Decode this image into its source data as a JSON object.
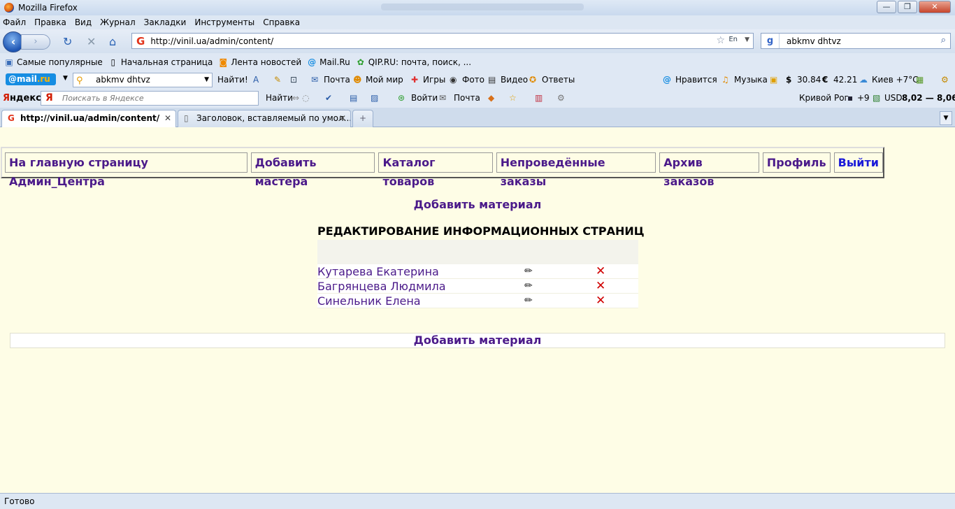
{
  "window": {
    "title": "Mozilla Firefox"
  },
  "menu": [
    "Файл",
    "Правка",
    "Вид",
    "Журнал",
    "Закладки",
    "Инструменты",
    "Справка"
  ],
  "nav": {
    "url": "http://vinil.ua/admin/content/",
    "search_value": "abkmv dhtvz",
    "lang": "En"
  },
  "bookmarks": [
    "Самые популярные",
    "Начальная страница",
    "Лента новостей",
    "Mail.Ru",
    "QIP.RU: почта, поиск, ..."
  ],
  "mailbar": {
    "logo_a": "@mail",
    "logo_b": ".ru",
    "search_value": "abkmv dhtvz",
    "find": "Найти!",
    "links": [
      "Почта",
      "Мой мир",
      "Игры",
      "Фото",
      "Видео",
      "Ответы"
    ],
    "right": [
      "Нравится",
      "Музыка",
      "30.84",
      "42.21",
      "Киев +7°C"
    ]
  },
  "yandexbar": {
    "logo_a": "Я",
    "logo_b": "ндекс",
    "placeholder": "Поискать в Яндексе",
    "find": "Найти",
    "login": "Войти",
    "mail": "Почта",
    "city": "Кривой Рог",
    "weather": "+9",
    "usd_label": "USD",
    "usd": "8,02 — 8,06"
  },
  "tabs": [
    {
      "label": "http://vinil.ua/admin/content/",
      "active": true
    },
    {
      "label": "Заголовок, вставляемый по умол...",
      "active": false
    }
  ],
  "admin_menu": [
    "На главную страницу Админ_Центра",
    "Добавить мастера",
    "Каталог товаров",
    "Непроведённые заказы",
    "Архив заказов",
    "Профиль",
    "Выйти"
  ],
  "page": {
    "add_material": "Добавить материал",
    "table_title": "РЕДАКТИРОВАНИЕ ИНФОРМАЦИОННЫХ СТРАНИЦ",
    "rows": [
      {
        "name": "Кутарева Екатерина"
      },
      {
        "name": "Багрянцева Людмила"
      },
      {
        "name": "Синельник Елена"
      }
    ]
  },
  "status": "Готово",
  "icons": {
    "edit": "pencil-icon",
    "delete": "delete-x-icon"
  }
}
